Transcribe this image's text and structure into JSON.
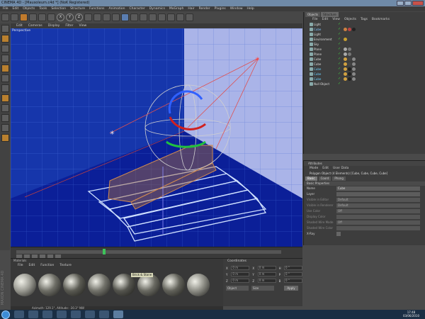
{
  "window": {
    "title": "CINEMA 4D - [Mausoleum.c4d *] (NoK Registered)"
  },
  "menubar": [
    "File",
    "Edit",
    "Objects",
    "Tools",
    "Selection",
    "Structure",
    "Functions",
    "Animation",
    "Character",
    "Dynamics",
    "MoGraph",
    "Hair",
    "Render",
    "Plugins",
    "Window",
    "Help"
  ],
  "toolbar": {
    "round_buttons": [
      "X",
      "Y",
      "Z"
    ]
  },
  "viewport": {
    "menu": [
      "Edit",
      "Cameras",
      "Display",
      "Filter",
      "View"
    ],
    "label": "Perspective"
  },
  "objects": {
    "tabs": [
      "Objects",
      "Structure"
    ],
    "menu": [
      "File",
      "Edit",
      "View",
      "Objects",
      "Tags",
      "Bookmarks"
    ],
    "items": [
      {
        "name": "Light",
        "style": "normal",
        "tags": []
      },
      {
        "name": "Cube",
        "style": "selected",
        "tags": [
          "#d08040",
          "#bb4444",
          "#222"
        ]
      },
      {
        "name": "Light",
        "style": "normal",
        "tags": []
      },
      {
        "name": "Environment",
        "style": "normal",
        "tags": [
          "#c8a030"
        ]
      },
      {
        "name": "Sky",
        "style": "normal",
        "tags": []
      },
      {
        "name": "Plane",
        "style": "normal",
        "tags": [
          "#aaaaaa",
          "#777777"
        ]
      },
      {
        "name": "Plane",
        "style": "normal",
        "tags": [
          "#aaaaaa",
          "#777777"
        ]
      },
      {
        "name": "Cube",
        "style": "normal",
        "tags": [
          "#d0a040",
          "#444",
          "#888"
        ]
      },
      {
        "name": "Cube",
        "style": "normal",
        "tags": [
          "#d0a040",
          "#444",
          "#888"
        ]
      },
      {
        "name": "Cube",
        "style": "cyan",
        "tags": [
          "#d0a040",
          "#222",
          "#888"
        ]
      },
      {
        "name": "Cube",
        "style": "cyan",
        "tags": [
          "#d0a040",
          "#222",
          "#888"
        ]
      },
      {
        "name": "Cube",
        "style": "cyan",
        "tags": [
          "#d0a040",
          "#222",
          "#888"
        ]
      },
      {
        "name": "Null Object",
        "style": "normal",
        "tags": []
      }
    ]
  },
  "attributes": {
    "title": "Attributes",
    "menu": [
      "Mode",
      "Edit",
      "User Data"
    ],
    "object": "Polygon Object (4 Elements) [Cube, Cube, Cube, Cube]",
    "tabs": [
      "Basic",
      "Coord",
      "Phong"
    ],
    "section": "Basic Properties",
    "rows": [
      {
        "label": "Name",
        "value": "Cube",
        "type": "field"
      },
      {
        "label": "Layer",
        "value": "",
        "type": "field"
      },
      {
        "label": "Visible in Editor",
        "value": "Default",
        "type": "dim"
      },
      {
        "label": "Visible in Renderer",
        "value": "Default",
        "type": "dim"
      },
      {
        "label": "Use Color",
        "value": "Off",
        "type": "dim"
      },
      {
        "label": "Display Color",
        "value": "",
        "type": "dim"
      },
      {
        "label": "Shaded Wire Mode",
        "value": "Off",
        "type": "dim"
      },
      {
        "label": "Shaded Wire Color",
        "value": "",
        "type": "dim"
      },
      {
        "label": "X-Ray",
        "value": "",
        "type": "check"
      }
    ]
  },
  "materials": {
    "title": "Materials",
    "menu": [
      "File",
      "Edit",
      "Function",
      "Texture"
    ],
    "swatches": [
      "#9a9a92",
      "#6e6e66",
      "#5a5a52",
      "#72726a",
      "#55554e",
      "#6a6a62",
      "#62625a",
      "#8e8e86"
    ],
    "tooltip": "Brick & Stone"
  },
  "coordinates": {
    "title": "Coordinates",
    "rows": [
      {
        "a": "X",
        "b": "X",
        "c": "H"
      },
      {
        "a": "Y",
        "b": "Y",
        "c": "P"
      },
      {
        "a": "Z",
        "b": "Z",
        "c": "B"
      }
    ],
    "values": [
      "0 m",
      "0 m",
      "0 °"
    ],
    "mode1": "Object",
    "mode2": "Size",
    "apply": "Apply"
  },
  "status": {
    "text": "Azimuth: 129.1°, Altitude: -30.3°  NW"
  },
  "clock": {
    "time": "17:48",
    "date": "03/06/2010"
  },
  "sidebar": {
    "brand": "MAXON CINEMA 4D"
  }
}
